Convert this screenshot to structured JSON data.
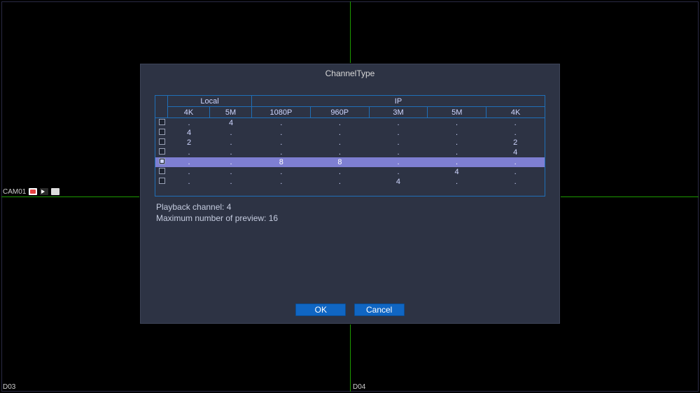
{
  "camera_labels": {
    "top_left": "CAM01",
    "bottom_left": "D03",
    "bottom_right": "D04"
  },
  "dialog": {
    "title": "ChannelType",
    "header_groups": {
      "local": "Local",
      "ip": "IP"
    },
    "columns": [
      "4K",
      "5M",
      "1080P",
      "960P",
      "3M",
      "5M",
      "4K"
    ],
    "rows": [
      {
        "checked": false,
        "selected": false,
        "cells": [
          ".",
          "4",
          ".",
          ".",
          ".",
          ".",
          "."
        ]
      },
      {
        "checked": false,
        "selected": false,
        "cells": [
          "4",
          ".",
          ".",
          ".",
          ".",
          ".",
          "."
        ]
      },
      {
        "checked": false,
        "selected": false,
        "cells": [
          "2",
          ".",
          ".",
          ".",
          ".",
          ".",
          "2"
        ]
      },
      {
        "checked": false,
        "selected": false,
        "cells": [
          ".",
          ".",
          ".",
          ".",
          ".",
          ".",
          "4"
        ]
      },
      {
        "checked": true,
        "selected": true,
        "cells": [
          ".",
          ".",
          "8",
          "8",
          ".",
          ".",
          "."
        ]
      },
      {
        "checked": false,
        "selected": false,
        "cells": [
          ".",
          ".",
          ".",
          ".",
          ".",
          "4",
          "."
        ]
      },
      {
        "checked": false,
        "selected": false,
        "cells": [
          ".",
          ".",
          ".",
          ".",
          "4",
          ".",
          "."
        ]
      }
    ],
    "info": {
      "playback": "Playback channel: 4",
      "preview": "Maximum number of preview: 16"
    },
    "buttons": {
      "ok": "OK",
      "cancel": "Cancel"
    }
  }
}
